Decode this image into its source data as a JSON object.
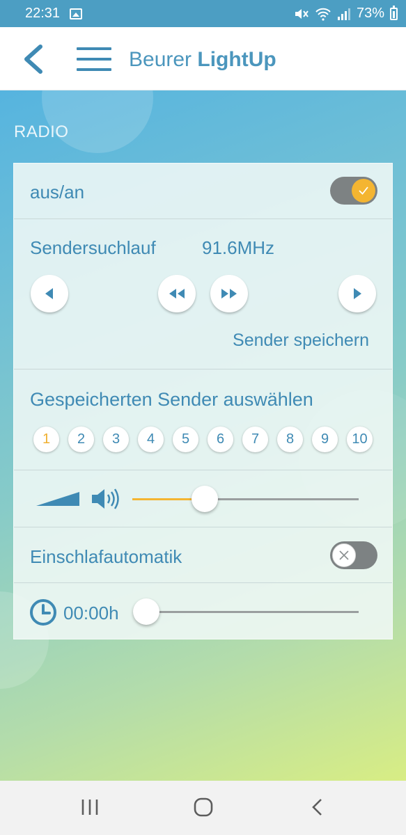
{
  "status_bar": {
    "time": "22:31",
    "battery": "73%"
  },
  "app_bar": {
    "title_prefix": "Beurer ",
    "title_bold": "LightUp"
  },
  "section": {
    "label": "RADIO"
  },
  "power": {
    "label": "aus/an",
    "on": true
  },
  "tuner": {
    "label": "Sendersuchlauf",
    "frequency": "91.6MHz",
    "save_label": "Sender speichern"
  },
  "presets": {
    "label": "Gespeicherten Sender auswählen",
    "items": [
      "1",
      "2",
      "3",
      "4",
      "5",
      "6",
      "7",
      "8",
      "9",
      "10"
    ],
    "selected": "1"
  },
  "volume": {
    "level": 0.32
  },
  "sleep": {
    "label": "Einschlafautomatik",
    "on": false
  },
  "timer": {
    "value": "00:00h",
    "level": 0.0
  },
  "colors": {
    "accent": "#f4b531",
    "primary": "#3f8ab4",
    "statusbar": "#4c9ec3"
  }
}
